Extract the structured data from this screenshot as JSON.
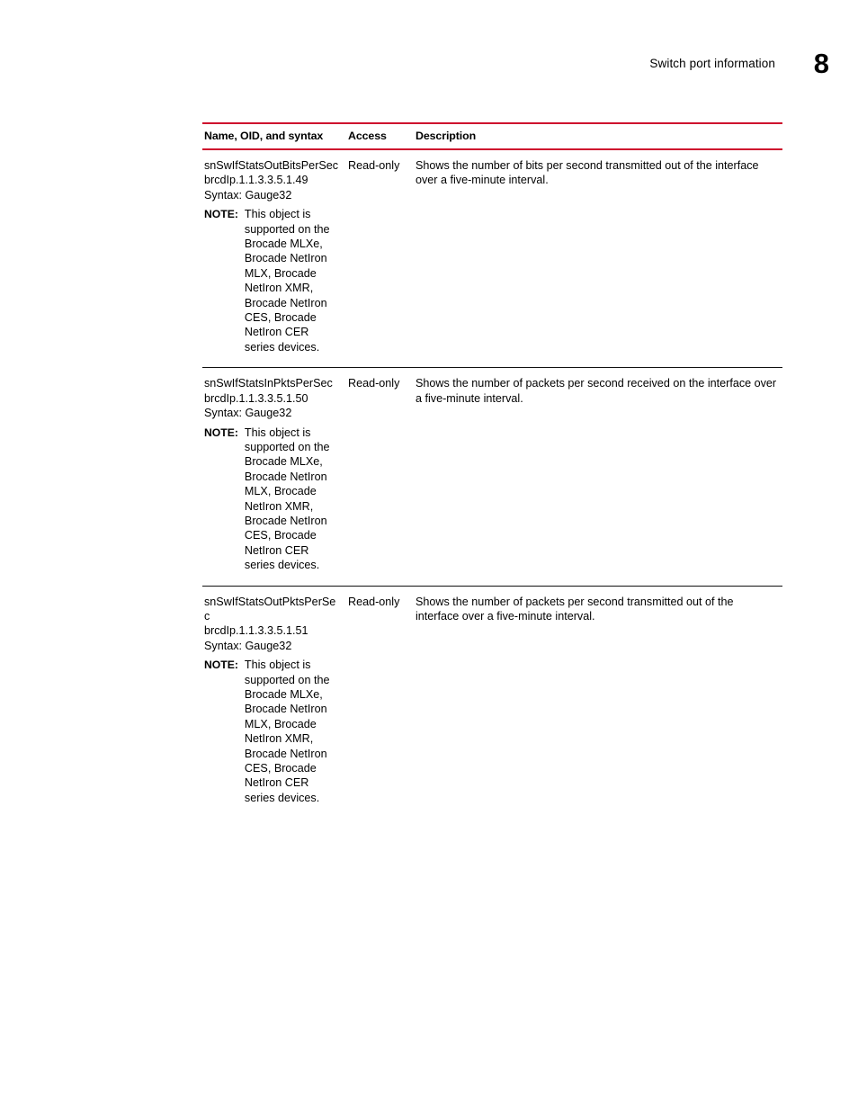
{
  "header": {
    "title": "Switch port information",
    "chapter": "8"
  },
  "table": {
    "columns": {
      "name": "Name, OID, and syntax",
      "access": "Access",
      "description": "Description"
    },
    "note_label": "NOTE:",
    "rows": [
      {
        "name": "snSwIfStatsOutBitsPerSec",
        "oid": "brcdIp.1.1.3.3.5.1.49",
        "syntax": "Syntax: Gauge32",
        "note": "This object is supported on the Brocade MLXe, Brocade NetIron MLX, Brocade NetIron XMR, Brocade NetIron CES, Brocade NetIron CER series devices.",
        "access": "Read-only",
        "description": "Shows the number of bits per second transmitted out of the interface over a five-minute interval."
      },
      {
        "name": "snSwIfStatsInPktsPerSec",
        "oid": "brcdIp.1.1.3.3.5.1.50",
        "syntax": "Syntax: Gauge32",
        "note": "This object is supported on the Brocade MLXe, Brocade NetIron MLX, Brocade NetIron XMR, Brocade NetIron CES, Brocade NetIron CER series devices.",
        "access": "Read-only",
        "description": "Shows the number of packets per second received on the interface over a five-minute interval."
      },
      {
        "name": "snSwIfStatsOutPktsPerSec",
        "oid": "brcdIp.1.1.3.3.5.1.51",
        "syntax": "Syntax: Gauge32",
        "note": "This object is supported on the Brocade MLXe, Brocade NetIron MLX, Brocade NetIron XMR, Brocade NetIron CES, Brocade NetIron CER series devices.",
        "access": "Read-only",
        "description": "Shows the number of packets per second transmitted out of the interface over a five-minute interval."
      }
    ]
  },
  "colors": {
    "rule_red": "#CE0E2D",
    "rule_dark": "#111111",
    "text": "#000000"
  }
}
